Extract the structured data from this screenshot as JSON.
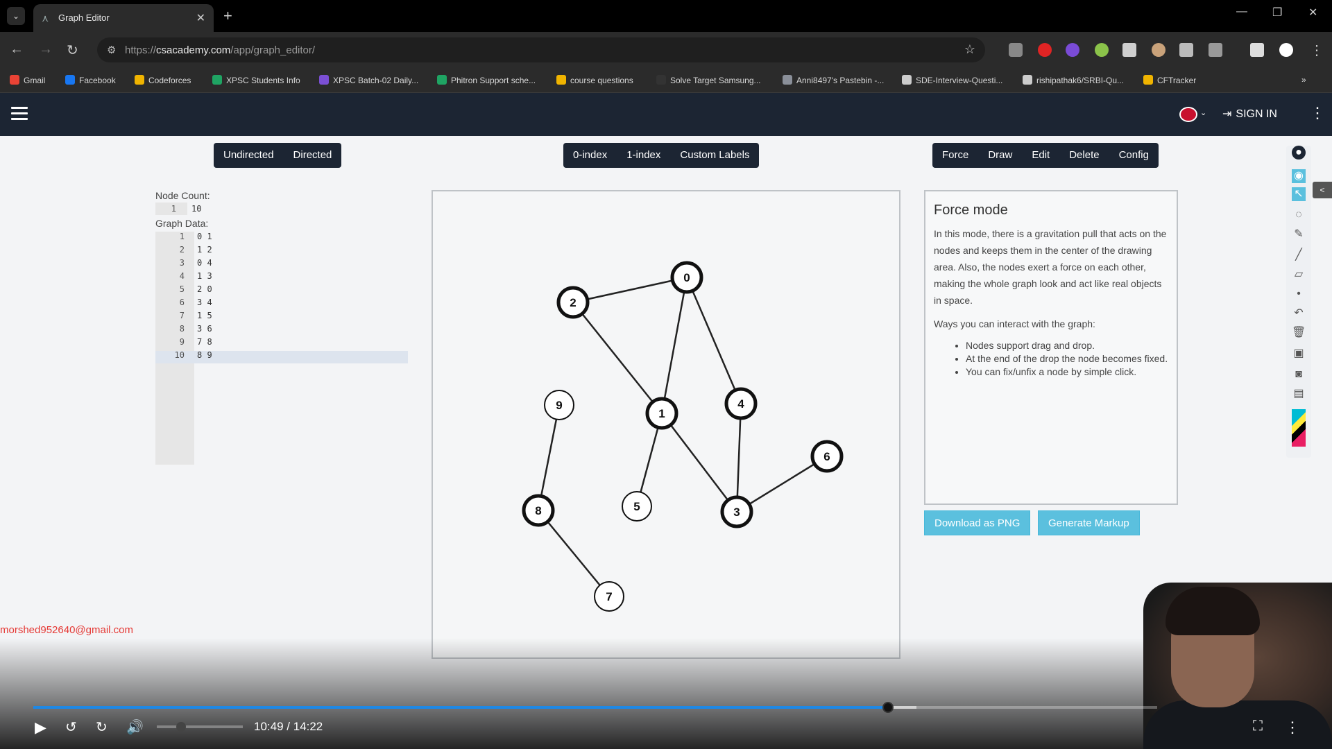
{
  "browser": {
    "tab_title": "Graph Editor",
    "url_prefix": "https://",
    "url_domain": "csacademy.com",
    "url_path": "/app/graph_editor/",
    "bookmarks": [
      {
        "label": "Gmail",
        "color": "#ea4335"
      },
      {
        "label": "Facebook",
        "color": "#1877f2"
      },
      {
        "label": "Codeforces",
        "color": "#f0b400"
      },
      {
        "label": "XPSC Students Info",
        "color": "#1fa463"
      },
      {
        "label": "XPSC Batch-02 Daily...",
        "color": "#7b4fd4"
      },
      {
        "label": "Phitron Support sche...",
        "color": "#1fa463"
      },
      {
        "label": "course questions",
        "color": "#f0b400"
      },
      {
        "label": "Solve Target Samsung...",
        "color": "#333333"
      },
      {
        "label": "Anni8497's Pastebin -...",
        "color": "#8a8f99"
      },
      {
        "label": "SDE-Interview-Questi...",
        "color": "#cccccc"
      },
      {
        "label": "rishipathak6/SRBI-Qu...",
        "color": "#cccccc"
      },
      {
        "label": "CFTracker",
        "color": "#f0b400"
      }
    ]
  },
  "header": {
    "signin_label": "SIGN IN"
  },
  "toolbar": {
    "direction": [
      "Undirected",
      "Directed"
    ],
    "indexing": [
      "0-index",
      "1-index",
      "Custom Labels"
    ],
    "modes": [
      "Force",
      "Draw",
      "Edit",
      "Delete",
      "Config"
    ]
  },
  "editor": {
    "node_count_label": "Node Count:",
    "node_count_line": "1",
    "node_count_value": "10",
    "graph_data_label": "Graph Data:",
    "edges": [
      {
        "line": "1",
        "text": "0 1"
      },
      {
        "line": "2",
        "text": "1 2"
      },
      {
        "line": "3",
        "text": "0 4"
      },
      {
        "line": "4",
        "text": "1 3"
      },
      {
        "line": "5",
        "text": "2 0"
      },
      {
        "line": "6",
        "text": "3 4"
      },
      {
        "line": "7",
        "text": "1 5"
      },
      {
        "line": "8",
        "text": "3 6"
      },
      {
        "line": "9",
        "text": "7 8"
      },
      {
        "line": "10",
        "text": "8 9"
      }
    ]
  },
  "graph": {
    "nodes": [
      {
        "id": "0",
        "bold": true
      },
      {
        "id": "1",
        "bold": true
      },
      {
        "id": "2",
        "bold": true
      },
      {
        "id": "3",
        "bold": true
      },
      {
        "id": "4",
        "bold": true
      },
      {
        "id": "5",
        "bold": false
      },
      {
        "id": "6",
        "bold": true
      },
      {
        "id": "7",
        "bold": false
      },
      {
        "id": "8",
        "bold": true
      },
      {
        "id": "9",
        "bold": false
      }
    ],
    "edges": [
      [
        "0",
        "1"
      ],
      [
        "1",
        "2"
      ],
      [
        "0",
        "4"
      ],
      [
        "1",
        "3"
      ],
      [
        "2",
        "0"
      ],
      [
        "3",
        "4"
      ],
      [
        "1",
        "5"
      ],
      [
        "3",
        "6"
      ],
      [
        "7",
        "8"
      ],
      [
        "8",
        "9"
      ]
    ]
  },
  "info": {
    "title": "Force mode",
    "paragraph": "In this mode, there is a gravitation pull that acts on the nodes and keeps them in the center of the drawing area. Also, the nodes exert a force on each other, making the whole graph look and act like real objects in space.",
    "ways_label": "Ways you can interact with the graph:",
    "bullets": [
      "Nodes support drag and drop.",
      "At the end of the drop the node becomes fixed.",
      "You can fix/unfix a node by simple click."
    ],
    "download_label": "Download as PNG",
    "markup_label": "Generate Markup"
  },
  "video": {
    "email": "morshed952640@gmail.com",
    "time": "10:49 / 14:22",
    "progress_fraction": 0.7606,
    "buffer_fraction": 0.786,
    "volume_fraction": 0.28
  },
  "colors": {
    "header_bg": "#1c2533",
    "accent": "#5bc0de",
    "progress": "#1e88e5",
    "email": "#e53935"
  }
}
